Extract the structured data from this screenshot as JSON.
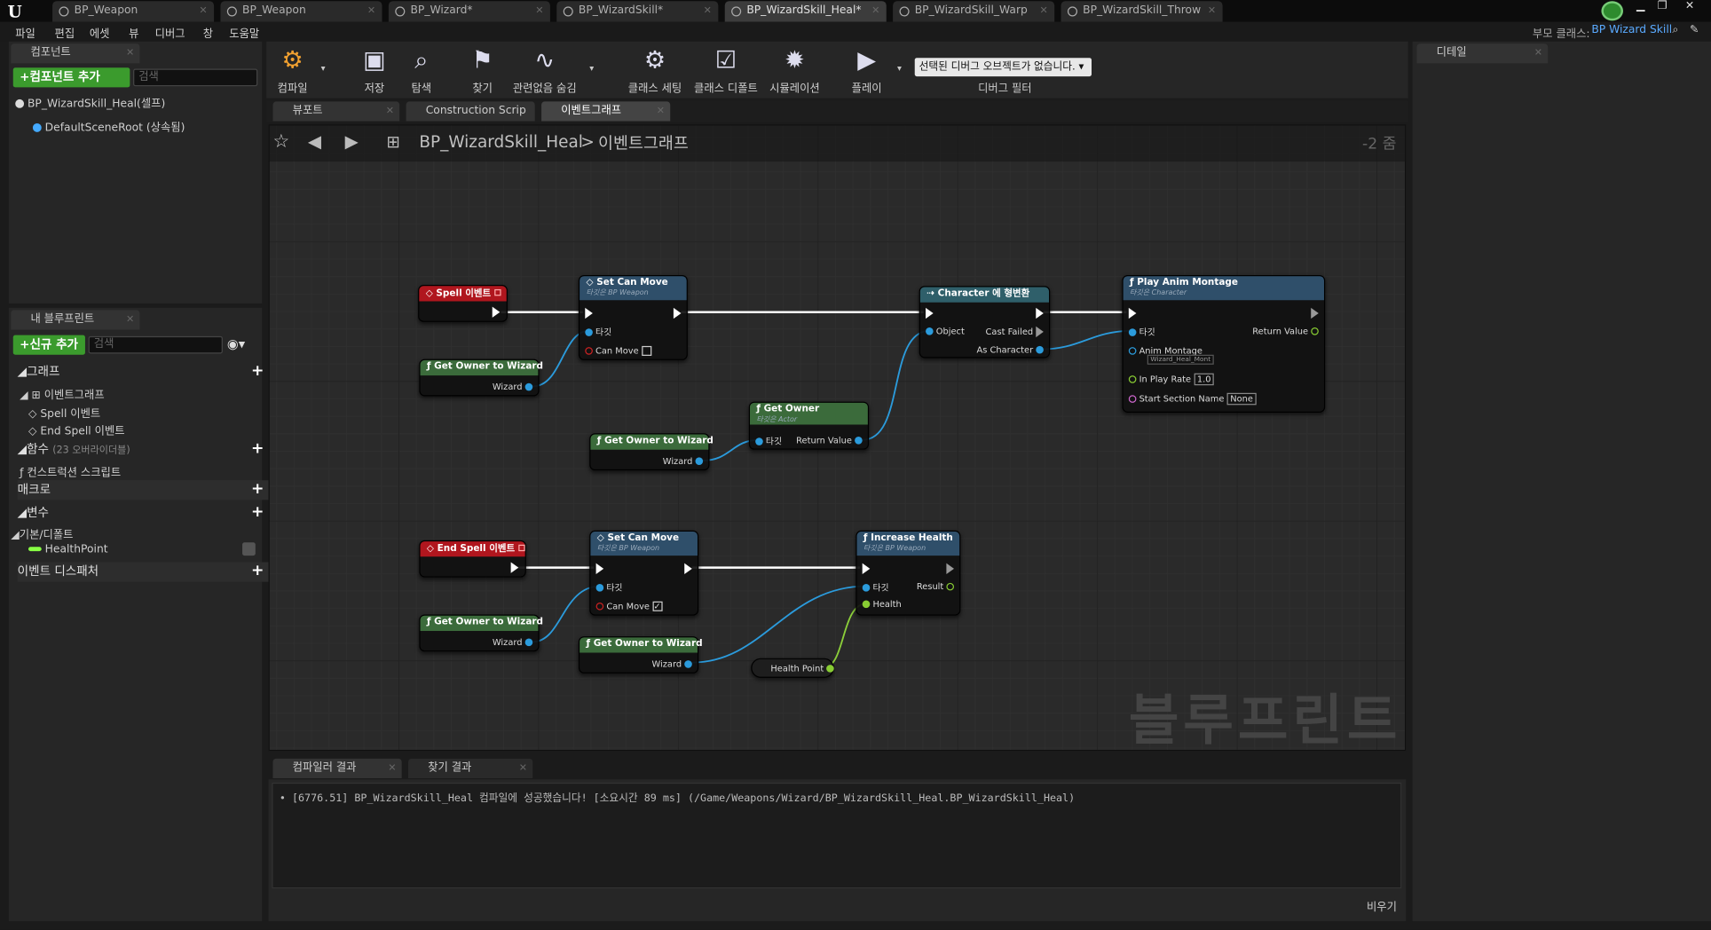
{
  "tabs": [
    "BP_Weapon",
    "BP_Weapon",
    "BP_Wizard*",
    "BP_WizardSkill*",
    "BP_WizardSkill_Heal*",
    "BP_WizardSkill_Warp",
    "BP_WizardSkill_Throw"
  ],
  "menu": [
    "파일",
    "편집",
    "에셋",
    "뷰",
    "디버그",
    "창",
    "도움말"
  ],
  "parent_class_label": "부모 클래스:",
  "parent_class_value": "BP Wizard Skill",
  "components": {
    "tab": "컴포넌트",
    "add": "+컴포넌트 추가",
    "search": "검색",
    "root": "BP_WizardSkill_Heal(셀프)",
    "child": "DefaultSceneRoot (상속됨)"
  },
  "toolbar": {
    "compile": "컴파일",
    "save": "저장",
    "browse": "탐색",
    "find": "찾기",
    "hide": "관련없음 숨김",
    "class_settings": "클래스 세팅",
    "class_defaults": "클래스 디폴트",
    "simulation": "시뮬레이션",
    "play": "플레이",
    "debug_select": "선택된 디버그 오브젝트가 없습니다.",
    "debug_filter": "디버그 필터"
  },
  "details_tab": "디테일",
  "editor_tabs": {
    "viewport": "뷰포트",
    "construction": "Construction Scrip",
    "eventgraph": "이벤트그래프"
  },
  "breadcrumb": {
    "bp": "BP_WizardSkill_Heal",
    "sep": ">",
    "graph": "이벤트그래프",
    "zoom": "-2 줌"
  },
  "myblueprint": {
    "tab": "내 블루프린트",
    "add": "+신규 추가",
    "search": "검색",
    "graphs": "그래프",
    "eventgraph": "이벤트그래프",
    "spell": "Spell 이벤트",
    "endspell": "End Spell 이벤트",
    "functions": "함수",
    "functions_sub": "(23 오버라이더블)",
    "construction": "컨스트럭션 스크립트",
    "macros": "매크로",
    "variables": "변수",
    "defaults": "기본/디폴트",
    "healthpoint": "HealthPoint",
    "dispatchers": "이벤트 디스패처"
  },
  "nodes": {
    "spell": "Spell 이벤트",
    "endspell": "End Spell 이벤트",
    "getowner": "Get Owner to Wizard",
    "wizard": "Wizard",
    "setcanmove": "Set Can Move",
    "target_bpweapon": "타깃은 BP Weapon",
    "target": "타깃",
    "canmove": "Can Move",
    "cast": "Character 에 형변환",
    "object": "Object",
    "castfailed": "Cast Failed",
    "ascharacter": "As Character",
    "getownerplain": "Get Owner",
    "target_actor": "타깃은 Actor",
    "returnvalue": "Return Value",
    "playanim": "Play Anim Montage",
    "target_character": "타깃은 Character",
    "animmontage": "Anim Montage",
    "montage_value": "Wizard_Heal_Mont",
    "inplayrate": "In Play Rate",
    "rate_value": "1.0",
    "startsection": "Start Section Name",
    "none": "None",
    "increasehealth": "Increase Health",
    "result": "Result",
    "health": "Health",
    "healthpoint": "Health Point"
  },
  "watermark": "블루프린트",
  "bottom": {
    "compiler": "컴파일러 결과",
    "find": "찾기 결과",
    "log": "[6776.51] BP_WizardSkill_Heal 컴파일에 성공했습니다! [소요시간 89 ms] (/Game/Weapons/Wizard/BP_WizardSkill_Heal.BP_WizardSkill_Heal)",
    "clear": "비우기"
  }
}
